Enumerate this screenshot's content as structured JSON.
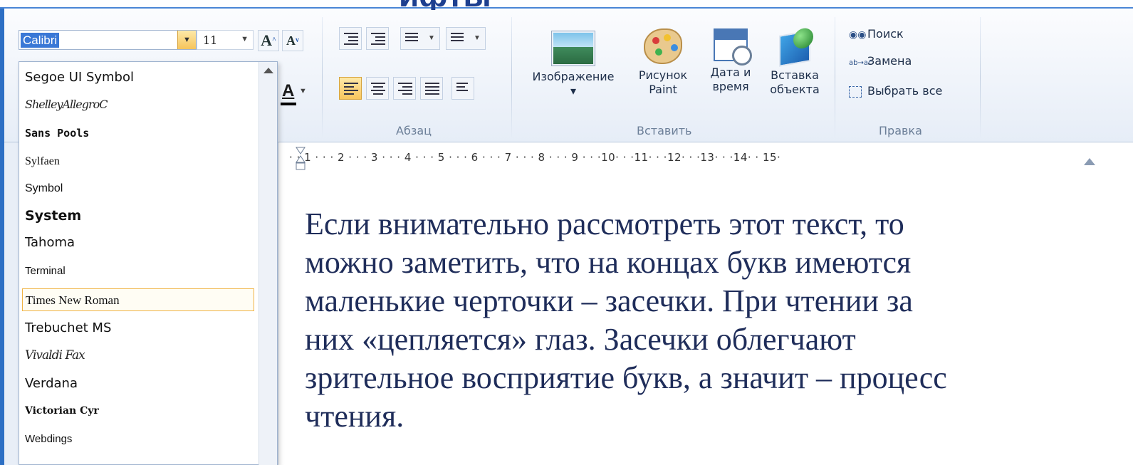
{
  "slide": {
    "accent_color": "#2d6fc4",
    "heading_fragment": "ифты"
  },
  "ribbon": {
    "font": {
      "name_value": "Calibri",
      "size_value": "11",
      "grow_label": "A",
      "shrink_label": "A",
      "color_label": "A"
    },
    "paragraph": {
      "group_label": "Абзац"
    },
    "insert": {
      "group_label": "Вставить",
      "items": [
        {
          "label_line1": "Изображение",
          "label_line2": "▾",
          "icon": "image-icon"
        },
        {
          "label_line1": "Рисунок",
          "label_line2": "Paint",
          "icon": "paint-palette-icon"
        },
        {
          "label_line1": "Дата и",
          "label_line2": "время",
          "icon": "date-time-icon"
        },
        {
          "label_line1": "Вставка",
          "label_line2": "объекта",
          "icon": "insert-object-icon"
        }
      ]
    },
    "edit": {
      "group_label": "Правка",
      "find": "Поиск",
      "replace": "Замена",
      "select_all": "Выбрать все",
      "replace_glyph": "ab→ac"
    }
  },
  "ruler": {
    "text": "· · 1 · · · 2 · · · 3 · · · 4 · · · 5 · · · 6 · · · 7 · · · 8 · · · 9 · · ·10· · ·11· · ·12· · ·13· · ·14· · 15·"
  },
  "font_dropdown": {
    "items": [
      {
        "label": "Segoe UI Symbol",
        "style": "sans"
      },
      {
        "label": "ShelleyAllegroC",
        "style": "script"
      },
      {
        "label": "Sans Pools",
        "style": "black"
      },
      {
        "label": "Sylfaen",
        "style": "serif-small"
      },
      {
        "label": "Symbol",
        "style": "sans-small"
      },
      {
        "label": "System",
        "style": "bold"
      },
      {
        "label": "Tahoma",
        "style": "sans"
      },
      {
        "label": "Terminal",
        "style": "sans-small"
      },
      {
        "label": "Times New Roman",
        "style": "serif",
        "selected": true
      },
      {
        "label": "Trebuchet MS",
        "style": "sans"
      },
      {
        "label": "Vivaldi Fax",
        "style": "script"
      },
      {
        "label": "Verdana",
        "style": "sans"
      },
      {
        "label": "Victorian Cyr",
        "style": "victorian"
      },
      {
        "label": "Webdings",
        "style": "sans-small"
      }
    ]
  },
  "document": {
    "lines": [
      "Если внимательно рассмотреть этот текст, то",
      "можно заметить, что на концах букв имеются",
      "маленькие черточки – засечки. При чтении за",
      "них «цепляется» глаз. Засечки облегчают",
      "зрительное восприятие букв, а значит – процесс",
      "чтения."
    ]
  }
}
